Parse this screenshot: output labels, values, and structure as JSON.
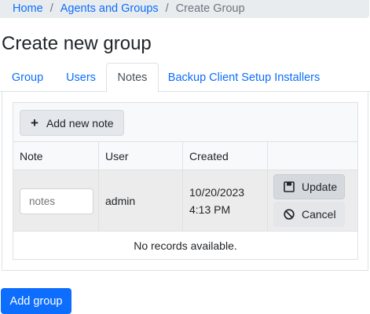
{
  "breadcrumb": {
    "items": [
      "Home",
      "Agents and Groups"
    ],
    "separator": "/",
    "active": "Create Group"
  },
  "page_title": "Create new group",
  "tabs": [
    {
      "label": "Group",
      "active": false
    },
    {
      "label": "Users",
      "active": false
    },
    {
      "label": "Notes",
      "active": true
    },
    {
      "label": "Backup Client Setup Installers",
      "active": false
    }
  ],
  "grid": {
    "add_note_label": "Add new note",
    "add_note_icon": "plus-icon",
    "columns": [
      "Note",
      "User",
      "Created",
      ""
    ],
    "edit_row": {
      "note_placeholder": "notes",
      "user": "admin",
      "created_date": "10/20/2023",
      "created_time": "4:13 PM",
      "update_label": "Update",
      "update_icon": "save-icon",
      "cancel_label": "Cancel",
      "cancel_icon": "cancel-icon"
    },
    "empty_message": "No records available."
  },
  "footer": {
    "add_group_label": "Add group"
  },
  "colors": {
    "primary": "#0d6efd",
    "breadcrumb_bg": "#e9ecef",
    "row_edit_bg": "#ececec"
  }
}
